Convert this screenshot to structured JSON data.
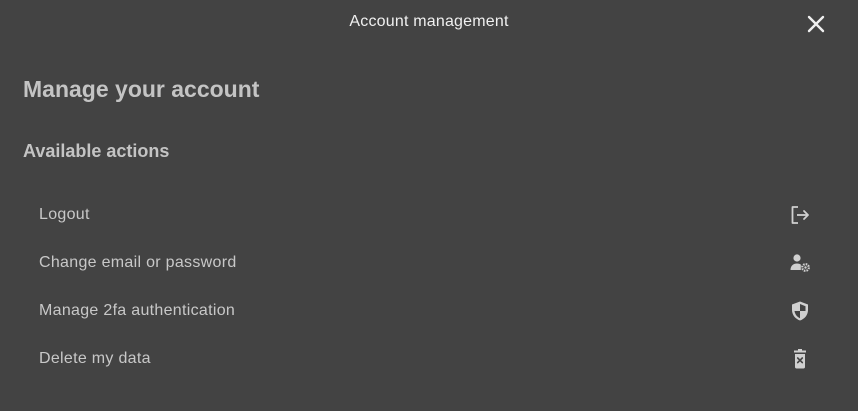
{
  "dialog": {
    "title": "Account management",
    "close_icon": "close-icon"
  },
  "main": {
    "heading": "Manage your account",
    "section_heading": "Available actions",
    "actions": [
      {
        "label": "Logout",
        "icon": "logout-icon"
      },
      {
        "label": "Change email or password",
        "icon": "user-gear-icon"
      },
      {
        "label": "Manage 2fa authentication",
        "icon": "shield-icon"
      },
      {
        "label": "Delete my data",
        "icon": "trash-icon"
      }
    ]
  },
  "colors": {
    "background": "#434343",
    "title_text": "#f0f0f0",
    "heading_text": "#c4c4c4",
    "item_text": "#c8c8c8",
    "icon": "#d0d0d0"
  }
}
